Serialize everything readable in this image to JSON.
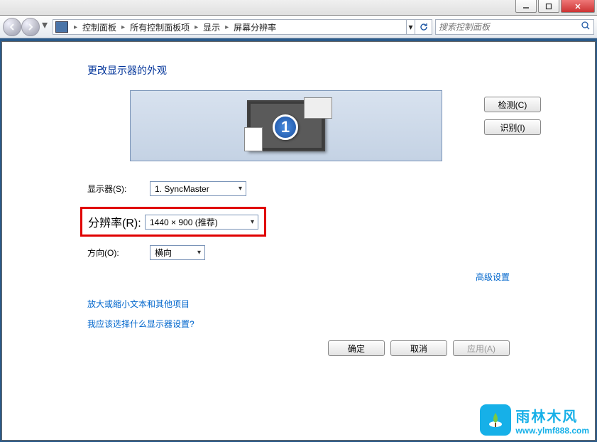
{
  "breadcrumb": {
    "items": [
      "控制面板",
      "所有控制面板项",
      "显示",
      "屏幕分辨率"
    ]
  },
  "search": {
    "placeholder": "搜索控制面板"
  },
  "page": {
    "title": "更改显示器的外观",
    "monitor_number": "1"
  },
  "buttons": {
    "detect": "检测(C)",
    "identify": "识别(I)",
    "ok": "确定",
    "cancel": "取消",
    "apply": "应用(A)"
  },
  "form": {
    "display_label": "显示器(S):",
    "display_value": "1. SyncMaster",
    "resolution_label": "分辨率(R):",
    "resolution_value": "1440 × 900 (推荐)",
    "orientation_label": "方向(O):",
    "orientation_value": "横向"
  },
  "links": {
    "advanced": "高级设置",
    "zoom": "放大或缩小文本和其他项目",
    "help": "我应该选择什么显示器设置?"
  },
  "watermark": {
    "cn": "雨林木风",
    "en": "www.ylmf888.com"
  }
}
